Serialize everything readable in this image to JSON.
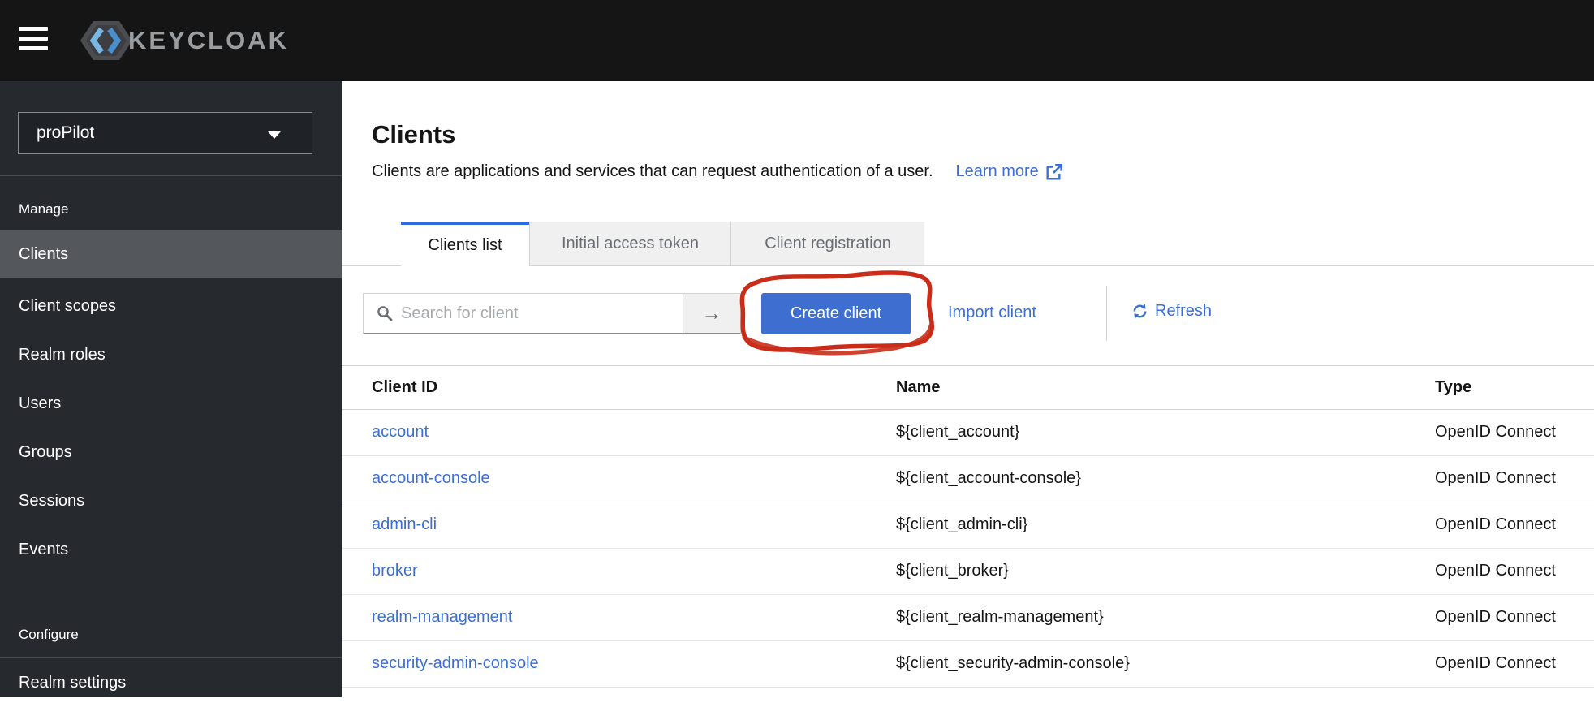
{
  "header": {
    "logo_text": "KEYCLOAK"
  },
  "sidebar": {
    "realm_selector": {
      "value": "proPilot"
    },
    "sections": [
      {
        "label": "Manage",
        "items": [
          {
            "label": "Clients",
            "active": true
          },
          {
            "label": "Client scopes"
          },
          {
            "label": "Realm roles"
          },
          {
            "label": "Users"
          },
          {
            "label": "Groups"
          },
          {
            "label": "Sessions"
          },
          {
            "label": "Events"
          }
        ]
      },
      {
        "label": "Configure",
        "items": [
          {
            "label": "Realm settings"
          }
        ]
      }
    ]
  },
  "main": {
    "title": "Clients",
    "description": "Clients are applications and services that can request authentication of a user.",
    "learn_more_label": "Learn more",
    "tabs": [
      {
        "label": "Clients list",
        "active": true
      },
      {
        "label": "Initial access token"
      },
      {
        "label": "Client registration"
      }
    ],
    "toolbar": {
      "search_placeholder": "Search for client",
      "create_button_label": "Create client",
      "import_link_label": "Import client",
      "refresh_label": "Refresh"
    },
    "table": {
      "columns": [
        "Client ID",
        "Name",
        "Type"
      ],
      "rows": [
        {
          "client_id": "account",
          "name": "${client_account}",
          "type": "OpenID Connect"
        },
        {
          "client_id": "account-console",
          "name": "${client_account-console}",
          "type": "OpenID Connect"
        },
        {
          "client_id": "admin-cli",
          "name": "${client_admin-cli}",
          "type": "OpenID Connect"
        },
        {
          "client_id": "broker",
          "name": "${client_broker}",
          "type": "OpenID Connect"
        },
        {
          "client_id": "realm-management",
          "name": "${client_realm-management}",
          "type": "OpenID Connect"
        },
        {
          "client_id": "security-admin-console",
          "name": "${client_security-admin-console}",
          "type": "OpenID Connect"
        }
      ]
    }
  },
  "annotation": {
    "type": "hand-drawn-circle",
    "target": "create-client-button",
    "color": "#c92d1a"
  },
  "colors": {
    "masthead_bg": "#151515",
    "sidebar_bg": "#26292d",
    "nav_current_bg": "#54575c",
    "accent_blue": "#3b6fd3",
    "button_blue": "#3e6fd0",
    "tab_active_border": "#2b6de0",
    "annotation_red": "#c92d1a"
  }
}
